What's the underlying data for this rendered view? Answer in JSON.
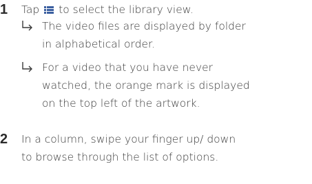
{
  "steps": [
    {
      "number": "1",
      "text_before_icon": "Tap",
      "icon": "list-view-icon",
      "text_after_icon": "to select the library view.",
      "results": [
        {
          "icon": "result-arrow-icon",
          "lines": [
            "The video files are displayed by folder",
            "in alphabetical order."
          ]
        },
        {
          "icon": "result-arrow-icon",
          "lines": [
            "For a video that you have never",
            "watched, the orange mark is displayed",
            "on the top left of the artwork."
          ]
        }
      ]
    },
    {
      "number": "2",
      "lines": [
        "In a column, swipe your finger up/ down",
        "to browse through the list of options."
      ]
    }
  ],
  "colors": {
    "text": "#3a3a3a",
    "accent": "#3b5fa0"
  }
}
